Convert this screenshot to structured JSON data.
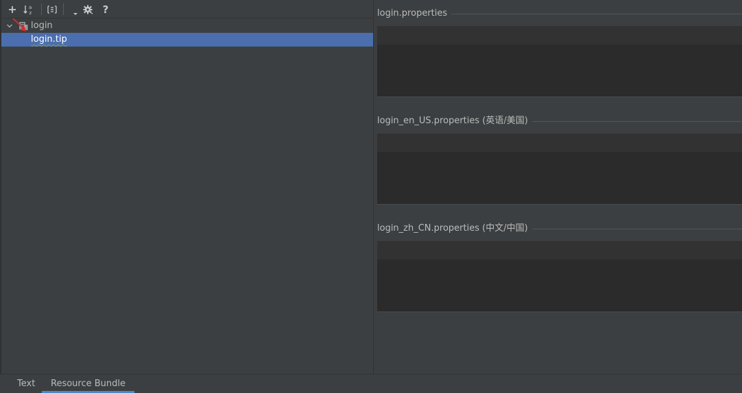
{
  "toolbar": {
    "buttons": [
      {
        "name": "add-icon"
      },
      {
        "name": "sort-alpha-icon"
      },
      {
        "name": "group-icon"
      },
      {
        "name": "dropdown-icon"
      },
      {
        "name": "gear-icon"
      },
      {
        "name": "help-icon",
        "label": "?"
      }
    ]
  },
  "tree": {
    "root": {
      "label": "login",
      "icon": "resource-bundle-icon",
      "expanded": true
    },
    "children": [
      {
        "label": "login.tip",
        "selected": true
      }
    ]
  },
  "editors": [
    {
      "title": "login.properties",
      "value": ""
    },
    {
      "title": "login_en_US.properties (英语/美国)",
      "value": ""
    },
    {
      "title": "login_zh_CN.properties (中文/中国)",
      "value": ""
    }
  ],
  "tabs": [
    {
      "label": "Text",
      "active": false
    },
    {
      "label": "Resource Bundle",
      "active": true
    }
  ],
  "colors": {
    "background": "#3c3f41",
    "selection": "#4b6eaf",
    "editor": "#2b2b2b",
    "tab_underline": "#4a88c7",
    "annotation_arrow": "#e02a2a"
  }
}
